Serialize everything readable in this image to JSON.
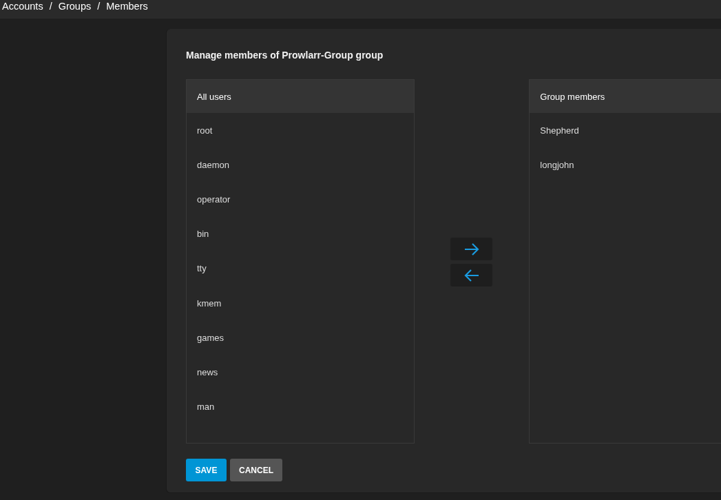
{
  "breadcrumb": {
    "separator": "/",
    "items": [
      "Accounts",
      "Groups",
      "Members"
    ]
  },
  "title": "Manage members of Prowlarr-Group group",
  "all_users": {
    "header": "All users",
    "items": [
      "root",
      "daemon",
      "operator",
      "bin",
      "tty",
      "kmem",
      "games",
      "news",
      "man"
    ]
  },
  "group_members": {
    "header": "Group members",
    "items": [
      "Shepherd",
      "longjohn"
    ]
  },
  "buttons": [
    {
      "label": "SAVE",
      "kind": "primary"
    },
    {
      "label": "CANCEL",
      "kind": "secondary"
    }
  ]
}
